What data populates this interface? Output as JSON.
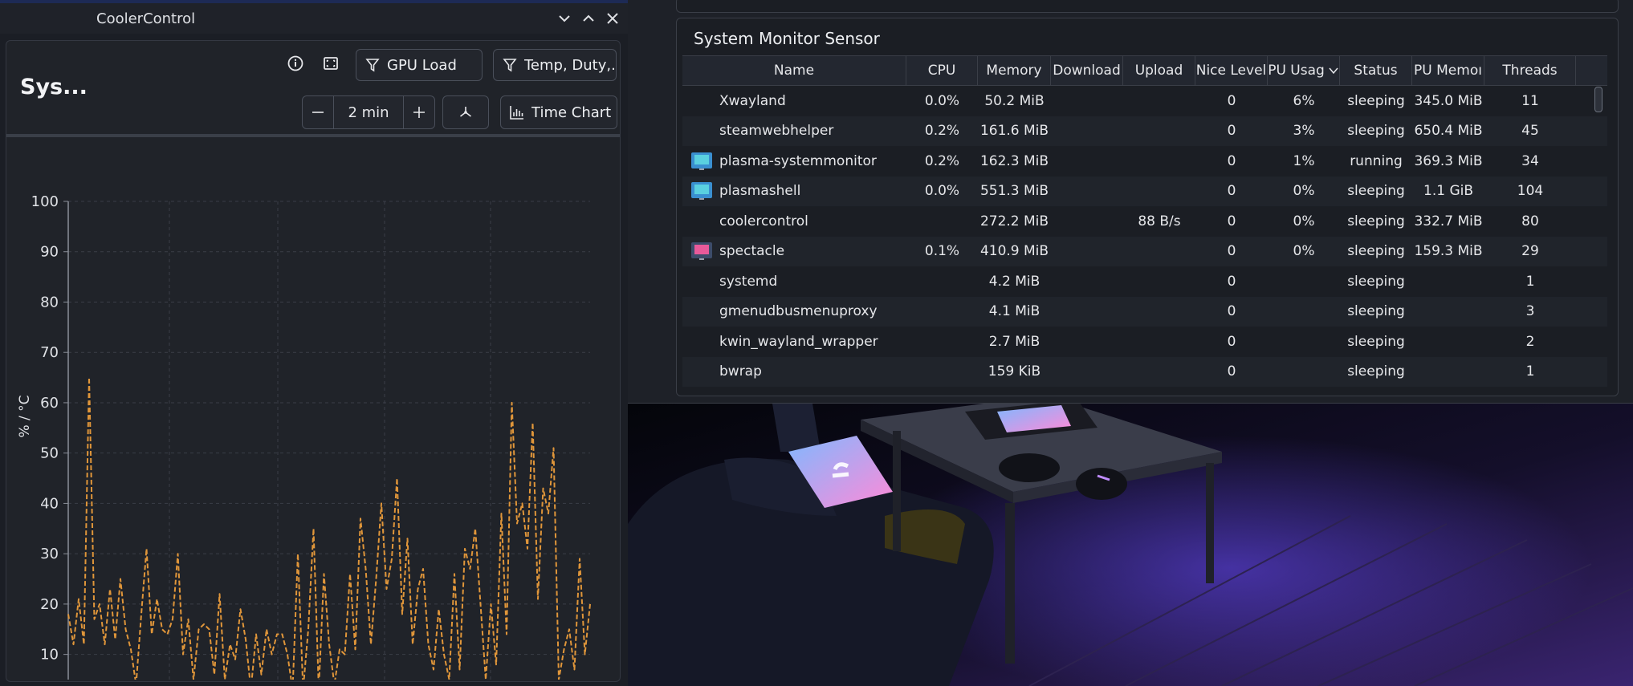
{
  "colors": {
    "accent": "#e0963a",
    "window_bg": "#1b1e25",
    "table_bg": "#1b1e24"
  },
  "coolercontrol": {
    "window_title": "CoolerControl",
    "window_controls": [
      "minimize",
      "maximize",
      "close"
    ],
    "dashboard_title": "Sys...",
    "filter_gpu_label": "GPU Load",
    "filter_temp_label": "Temp, Duty,...",
    "duration_value": "2 min",
    "chart_type_label": "Time Chart"
  },
  "chart_data": {
    "type": "line",
    "ylabel": "% / °C",
    "ylim": [
      5,
      100
    ],
    "yticks": [
      10,
      20,
      30,
      40,
      50,
      60,
      70,
      80,
      90,
      100
    ],
    "grid": true,
    "series": [
      {
        "color": "#e0963a",
        "style": "dashed",
        "values": [
          18,
          12,
          21,
          12,
          65,
          17,
          20,
          12,
          23,
          13,
          25,
          15,
          11,
          4,
          18,
          31,
          14,
          21,
          15,
          14,
          17,
          30,
          10,
          17,
          5,
          15,
          16,
          15,
          6,
          22,
          5,
          12,
          9,
          19,
          13,
          3,
          14,
          6,
          15,
          10,
          14,
          14,
          10,
          3,
          30,
          3,
          15,
          35,
          3,
          26,
          12,
          4,
          11,
          10,
          26,
          11,
          37,
          27,
          12,
          25,
          40,
          23,
          29,
          45,
          18,
          33,
          12,
          23,
          27,
          12,
          7,
          19,
          10,
          5,
          26,
          7,
          31,
          27,
          35,
          20,
          5,
          20,
          8,
          38,
          14,
          60,
          36,
          40,
          31,
          56,
          21,
          43,
          38,
          51,
          5,
          11,
          15,
          7,
          29,
          10,
          20
        ]
      }
    ]
  },
  "sysmon": {
    "title": "System Monitor Sensor",
    "columns": [
      "Name",
      "CPU",
      "Memory",
      "Download",
      "Upload",
      "Nice Level",
      "PU Usag",
      "Status",
      "PU Memoı",
      "Threads"
    ],
    "rows": [
      {
        "icon": "",
        "name": "Xwayland",
        "cpu": "0.0%",
        "memory": "50.2 MiB",
        "download": "",
        "upload": "",
        "nice": "0",
        "gpu_usage": "6%",
        "status": "sleeping",
        "gpu_memory": "345.0 MiB",
        "threads": "11"
      },
      {
        "icon": "",
        "name": "steamwebhelper",
        "cpu": "0.2%",
        "memory": "161.6 MiB",
        "download": "",
        "upload": "",
        "nice": "0",
        "gpu_usage": "3%",
        "status": "sleeping",
        "gpu_memory": "650.4 MiB",
        "threads": "45"
      },
      {
        "icon": "plasma-systemmonitor-icon",
        "name": "plasma-systemmonitor",
        "cpu": "0.2%",
        "memory": "162.3 MiB",
        "download": "",
        "upload": "",
        "nice": "0",
        "gpu_usage": "1%",
        "status": "running",
        "gpu_memory": "369.3 MiB",
        "threads": "34"
      },
      {
        "icon": "plasmashell-icon",
        "name": "plasmashell",
        "cpu": "0.0%",
        "memory": "551.3 MiB",
        "download": "",
        "upload": "",
        "nice": "0",
        "gpu_usage": "0%",
        "status": "sleeping",
        "gpu_memory": "1.1 GiB",
        "threads": "104"
      },
      {
        "icon": "",
        "name": "coolercontrol",
        "cpu": "",
        "memory": "272.2 MiB",
        "download": "",
        "upload": "88 B/s",
        "nice": "0",
        "gpu_usage": "0%",
        "status": "sleeping",
        "gpu_memory": "332.7 MiB",
        "threads": "80"
      },
      {
        "icon": "spectacle-icon",
        "name": "spectacle",
        "cpu": "0.1%",
        "memory": "410.9 MiB",
        "download": "",
        "upload": "",
        "nice": "0",
        "gpu_usage": "0%",
        "status": "sleeping",
        "gpu_memory": "159.3 MiB",
        "threads": "29"
      },
      {
        "icon": "",
        "name": "systemd",
        "cpu": "",
        "memory": "4.2 MiB",
        "download": "",
        "upload": "",
        "nice": "0",
        "gpu_usage": "",
        "status": "sleeping",
        "gpu_memory": "",
        "threads": "1"
      },
      {
        "icon": "",
        "name": "gmenudbusmenuproxy",
        "cpu": "",
        "memory": "4.1 MiB",
        "download": "",
        "upload": "",
        "nice": "0",
        "gpu_usage": "",
        "status": "sleeping",
        "gpu_memory": "",
        "threads": "3"
      },
      {
        "icon": "",
        "name": "kwin_wayland_wrapper",
        "cpu": "",
        "memory": "2.7 MiB",
        "download": "",
        "upload": "",
        "nice": "0",
        "gpu_usage": "",
        "status": "sleeping",
        "gpu_memory": "",
        "threads": "2"
      },
      {
        "icon": "",
        "name": "bwrap",
        "cpu": "",
        "memory": "159 KiB",
        "download": "",
        "upload": "",
        "nice": "0",
        "gpu_usage": "",
        "status": "sleeping",
        "gpu_memory": "",
        "threads": "1"
      }
    ]
  }
}
